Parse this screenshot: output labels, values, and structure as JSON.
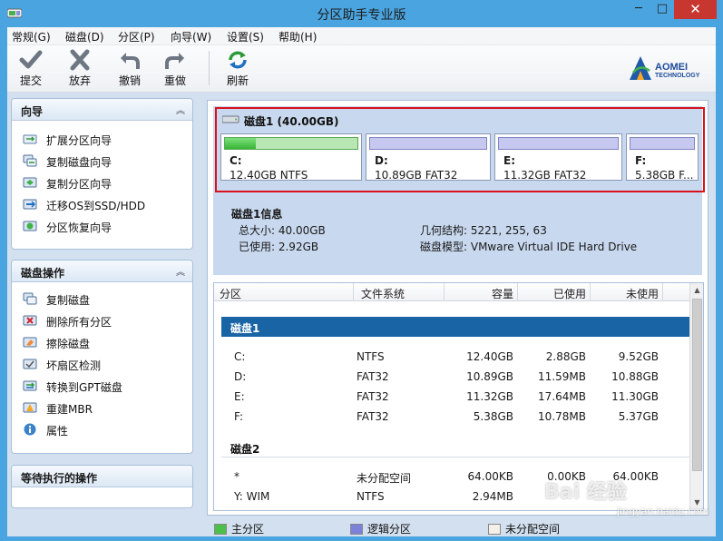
{
  "window": {
    "title": "分区助手专业版",
    "min": "─",
    "max": "□",
    "close": "✕"
  },
  "menu": [
    "常规(G)",
    "磁盘(D)",
    "分区(P)",
    "向导(W)",
    "设置(S)",
    "帮助(H)"
  ],
  "toolbar": {
    "commit": "提交",
    "discard": "放弃",
    "undo": "撤销",
    "redo": "重做",
    "refresh": "刷新"
  },
  "logo": {
    "brand": "AOMEI",
    "sub": "TECHNOLOGY"
  },
  "wizard_panel": {
    "title": "向导",
    "items": [
      "扩展分区向导",
      "复制磁盘向导",
      "复制分区向导",
      "迁移OS到SSD/HDD",
      "分区恢复向导"
    ]
  },
  "disk_ops_panel": {
    "title": "磁盘操作",
    "items": [
      "复制磁盘",
      "删除所有分区",
      "擦除磁盘",
      "坏扇区检测",
      "转换到GPT磁盘",
      "重建MBR",
      "属性"
    ]
  },
  "pending_panel": {
    "title": "等待执行的操作"
  },
  "disk_map": {
    "header": "磁盘1 (40.00GB)",
    "partitions": [
      {
        "letter": "C:",
        "info": "12.40GB NTFS",
        "used_fraction": 0.23
      },
      {
        "letter": "D:",
        "info": "10.89GB FAT32",
        "used_fraction": 0.0
      },
      {
        "letter": "E:",
        "info": "11.32GB FAT32",
        "used_fraction": 0.0
      },
      {
        "letter": "F:",
        "info": "5.38GB F...",
        "used_fraction": 0.0
      }
    ]
  },
  "disk_info": {
    "title": "磁盘1信息",
    "total_label": "总大小: 40.00GB",
    "used_label": "已使用: 2.92GB",
    "geometry_label": "几何结构: 5221, 255, 63",
    "model_label": "磁盘模型: VMware Virtual IDE Hard Drive"
  },
  "table": {
    "headers": [
      "分区",
      "文件系统",
      "容量",
      "已使用",
      "未使用"
    ],
    "groups": [
      {
        "name": "磁盘1",
        "rows": [
          [
            "C:",
            "NTFS",
            "12.40GB",
            "2.88GB",
            "9.52GB"
          ],
          [
            "D:",
            "FAT32",
            "10.89GB",
            "11.59MB",
            "10.88GB"
          ],
          [
            "E:",
            "FAT32",
            "11.32GB",
            "17.64MB",
            "11.30GB"
          ],
          [
            "F:",
            "FAT32",
            "5.38GB",
            "10.78MB",
            "5.37GB"
          ]
        ]
      },
      {
        "name": "磁盘2",
        "rows": [
          [
            "*",
            "未分配空间",
            "64.00KB",
            "0.00KB",
            "64.00KB"
          ],
          [
            "Y: WIM",
            "NTFS",
            "2.94MB",
            "",
            ""
          ]
        ]
      }
    ]
  },
  "legend": {
    "primary": "主分区",
    "logical": "逻辑分区",
    "unallocated": "未分配空间"
  },
  "watermark": {
    "main": "Bai 经验",
    "url": "jingyan.baidu.com"
  },
  "colors": {
    "titlebar": "#4aa4df",
    "close": "#c7372f",
    "selected_row": "#1864a5",
    "highlight_border": "#d8131d",
    "primary_bar": "#38b536",
    "logical_bar": "#c6c8ef"
  }
}
